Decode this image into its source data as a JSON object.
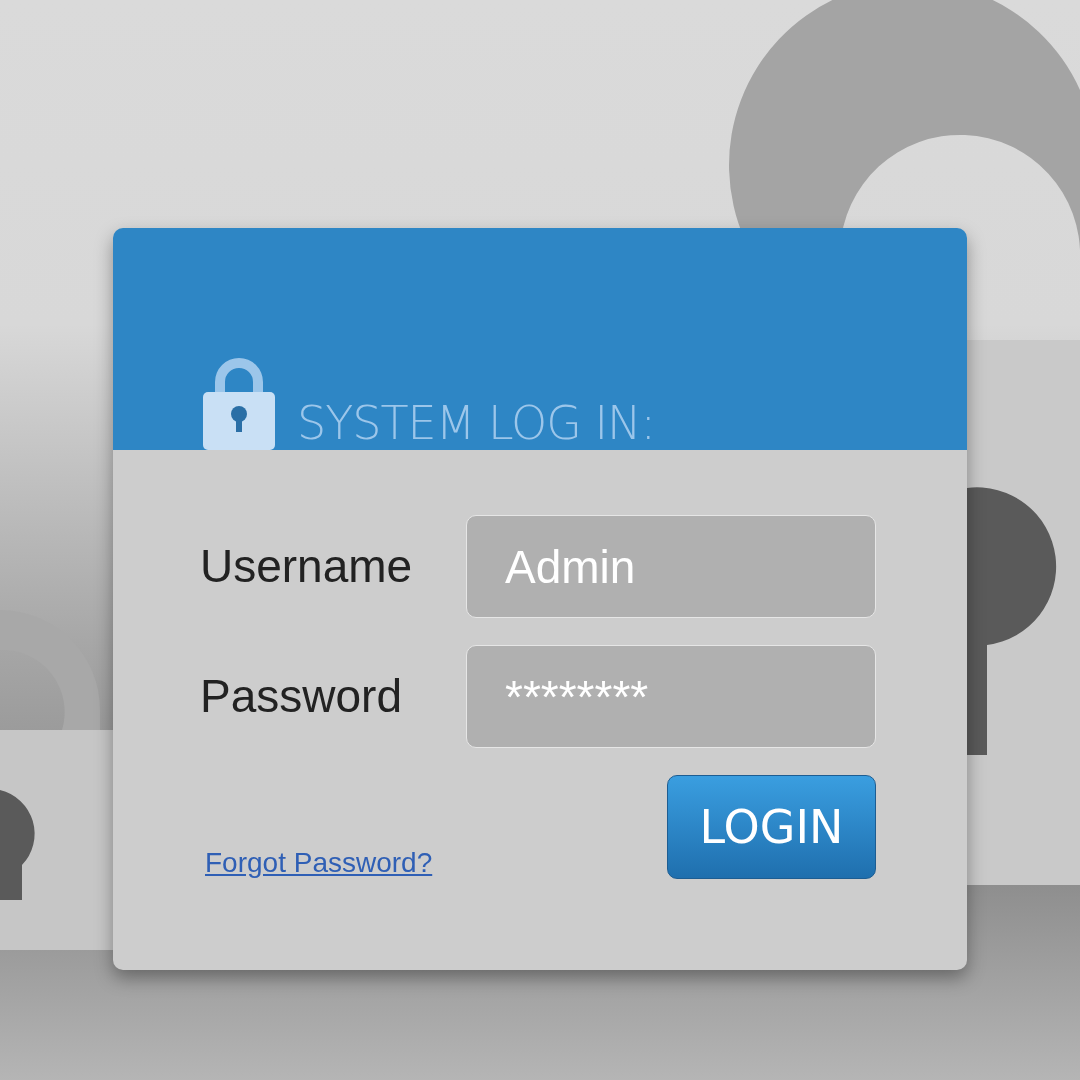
{
  "header": {
    "title": "SYSTEM LOG IN:"
  },
  "fields": [
    {
      "label": "Username",
      "value": "Admin"
    },
    {
      "label": "Password",
      "value": "********"
    }
  ],
  "login_button": "LOGIN",
  "forgot_link": "Forgot Password?"
}
